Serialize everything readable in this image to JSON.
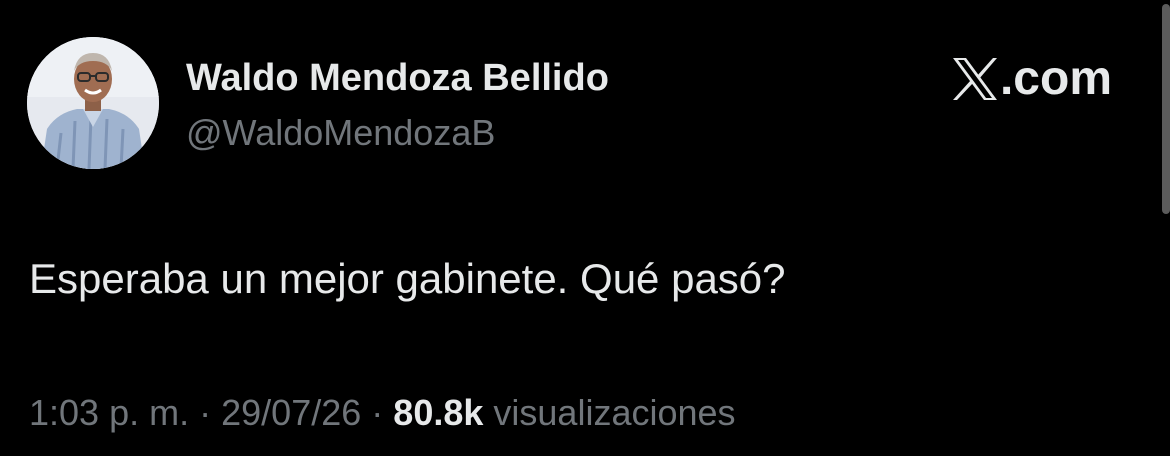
{
  "author": {
    "display_name": "Waldo Mendoza Bellido",
    "handle": "@WaldoMendozaB"
  },
  "brand": {
    "icon": "x-logo-icon",
    "label": ".com"
  },
  "tweet": {
    "text": "Esperaba un mejor gabinete. Qué pasó?"
  },
  "meta": {
    "time": "1:03 p. m.",
    "separator": "·",
    "date": "29/07/26",
    "views_count": "80.8k",
    "views_label": "visualizaciones"
  },
  "colors": {
    "background": "#000000",
    "primary_text": "#e7e9ea",
    "secondary_text": "#71767b"
  }
}
